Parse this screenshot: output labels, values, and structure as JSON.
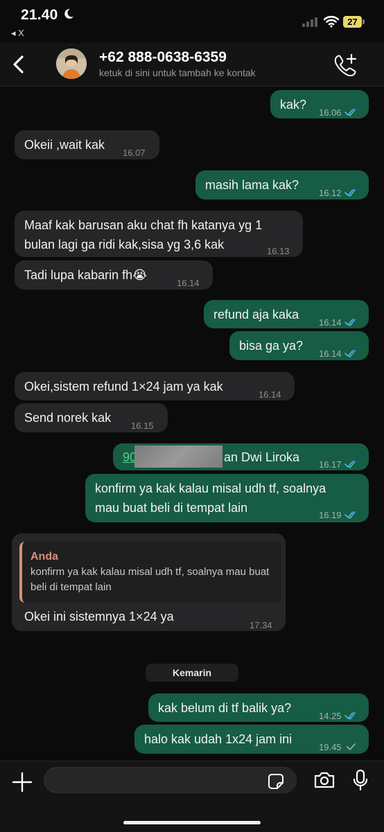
{
  "status_bar": {
    "time": "21.40",
    "back_app": "◂ X",
    "battery": "27"
  },
  "header": {
    "contact_name": "+62 888-0638-6359",
    "contact_subtitle": "ketuk di sini untuk tambah ke kontak"
  },
  "messages": [
    {
      "dir": "out",
      "text": "kak?",
      "time": "16.06",
      "status": "read"
    },
    {
      "dir": "in",
      "text": "Okeii ,wait kak",
      "time": "16.07"
    },
    {
      "dir": "out",
      "text": "masih lama kak?",
      "time": "16.12",
      "status": "read"
    },
    {
      "dir": "in",
      "line1": "Maaf kak barusan aku chat fh katanya yg 1",
      "line2": "bulan lagi ga ridi kak,sisa yg 3,6 kak",
      "time": "16.13"
    },
    {
      "dir": "in",
      "text": "Tadi lupa kabarin fh😭",
      "time": "16.14"
    },
    {
      "dir": "out",
      "text": "refund aja kaka",
      "time": "16.14",
      "status": "read"
    },
    {
      "dir": "out",
      "text": "bisa ga ya?",
      "time": "16.14",
      "status": "read"
    },
    {
      "dir": "in",
      "text": "Okei,sistem refund 1×24 jam ya kak",
      "time": "16.14"
    },
    {
      "dir": "in",
      "text": "Send norek kak",
      "time": "16.15"
    },
    {
      "dir": "out",
      "link_prefix": "90",
      "text_suffix": "an Dwi Liroka",
      "time": "16.17",
      "status": "read"
    },
    {
      "dir": "out",
      "line1": "konfirm ya kak kalau misal udh tf, soalnya",
      "line2": "mau buat beli di tempat lain",
      "time": "16.19",
      "status": "read"
    },
    {
      "dir": "in",
      "quote_author": "Anda",
      "quote_text": "konfirm ya kak kalau misal udh tf, soalnya mau buat beli di tempat lain",
      "text": "Okei ini sistemnya 1×24 ya",
      "time": "17.34"
    },
    {
      "dir": "out",
      "text": "kak belum di tf balik ya?",
      "time": "14.25",
      "status": "read"
    },
    {
      "dir": "out",
      "text": "halo kak udah 1x24 jam ini",
      "time": "19.45",
      "status": "sent"
    }
  ],
  "date_separator": "Kemarin",
  "composer": {
    "placeholder": ""
  },
  "colors": {
    "incoming": "#262628",
    "outgoing": "#175c45",
    "read_tick": "#4fb6ec",
    "quote_accent": "#d8907a"
  },
  "icons": [
    "moon-icon",
    "signal-icon",
    "wifi-icon",
    "battery-icon",
    "back-chevron-icon",
    "call-add-icon",
    "plus-icon",
    "sticker-icon",
    "camera-icon",
    "mic-icon",
    "double-check-icon",
    "single-check-icon"
  ]
}
